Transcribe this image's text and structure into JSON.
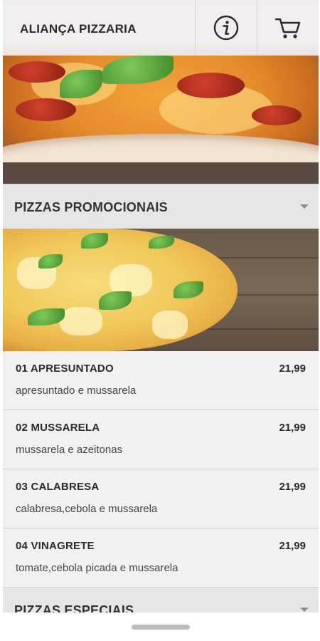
{
  "header": {
    "title": "ALIANÇA PIZZARIA",
    "info_icon": "info-icon",
    "cart_icon": "cart-icon"
  },
  "sections": [
    {
      "title": "PIZZAS PROMOCIONAIS",
      "expanded": true,
      "items": [
        {
          "name": "01 APRESUNTADO",
          "price": "21,99",
          "description": "apresuntado e mussarela"
        },
        {
          "name": "02 MUSSARELA",
          "price": "21,99",
          "description": "mussarela e azeitonas"
        },
        {
          "name": "03 CALABRESA",
          "price": "21,99",
          "description": "calabresa,cebola e mussarela"
        },
        {
          "name": "04 VINAGRETE",
          "price": "21,99",
          "description": "tomate,cebola picada e mussarela"
        }
      ]
    },
    {
      "title": "PIZZAS ESPECIAIS",
      "expanded": false
    }
  ],
  "colors": {
    "header_bg": "#efeded",
    "section_bg": "#e6e6e6",
    "item_bg": "#f1f1f1",
    "text": "#2a2a2a"
  }
}
